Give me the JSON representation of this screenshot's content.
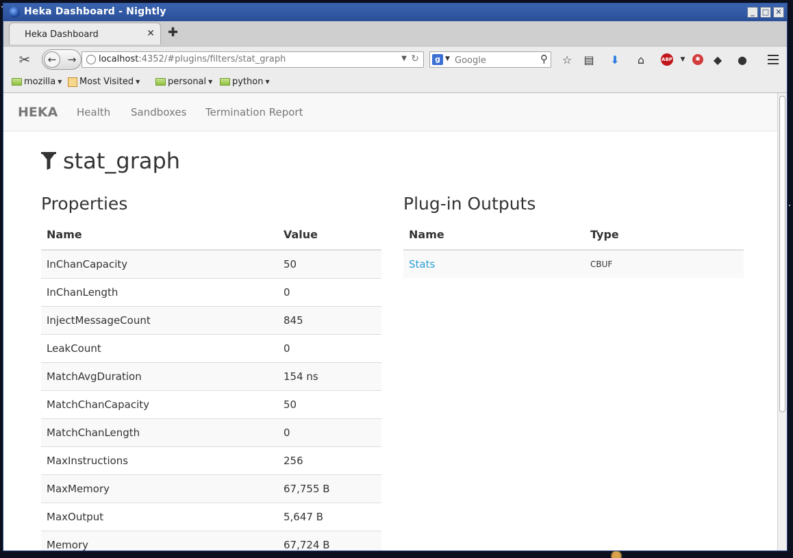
{
  "window": {
    "title": "Heka Dashboard - Nightly"
  },
  "tab": {
    "label": "Heka Dashboard",
    "close": "✕",
    "new": "✚"
  },
  "toolbar": {
    "url_host": "localhost",
    "url_rest": ":4352/#plugins/filters/stat_graph",
    "search_engine": "g",
    "search_placeholder": "Google",
    "adblock_label": "ABP"
  },
  "bookmarks": [
    {
      "label": "mozilla"
    },
    {
      "label": "Most Visited"
    },
    {
      "label": "personal"
    },
    {
      "label": "python"
    }
  ],
  "app": {
    "brand": "HEKA",
    "nav": [
      "Health",
      "Sandboxes",
      "Termination Report"
    ],
    "page_title": "stat_graph",
    "properties": {
      "title": "Properties",
      "headers": [
        "Name",
        "Value"
      ],
      "rows": [
        [
          "InChanCapacity",
          "50"
        ],
        [
          "InChanLength",
          "0"
        ],
        [
          "InjectMessageCount",
          "845"
        ],
        [
          "LeakCount",
          "0"
        ],
        [
          "MatchAvgDuration",
          "154 ns"
        ],
        [
          "MatchChanCapacity",
          "50"
        ],
        [
          "MatchChanLength",
          "0"
        ],
        [
          "MaxInstructions",
          "256"
        ],
        [
          "MaxMemory",
          "67,755 B"
        ],
        [
          "MaxOutput",
          "5,647 B"
        ],
        [
          "Memory",
          "67,724 B"
        ]
      ]
    },
    "outputs": {
      "title": "Plug-in Outputs",
      "headers": [
        "Name",
        "Type"
      ],
      "rows": [
        [
          "Stats",
          "CBUF"
        ]
      ]
    }
  },
  "colors": {
    "titlebar": "#2f5aa6",
    "link": "#2a9fd6"
  }
}
